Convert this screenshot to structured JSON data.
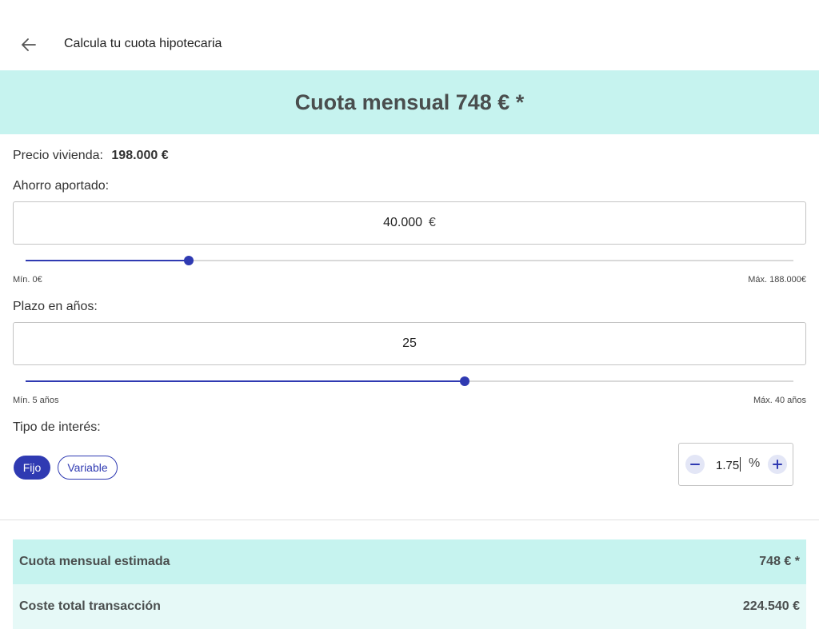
{
  "header": {
    "title": "Calcula tu cuota hipotecaria"
  },
  "banner": {
    "text": "Cuota mensual 748 € *"
  },
  "price": {
    "label": "Precio vivienda:",
    "value": "198.000 €"
  },
  "savings": {
    "label": "Ahorro aportado:",
    "value": "40.000",
    "unit": "€",
    "slider_value": 40000,
    "slider_min": 0,
    "slider_max": 188000,
    "min_label": "Mín. 0€",
    "max_label": "Máx. 188.000€"
  },
  "term": {
    "label": "Plazo en años:",
    "value": "25",
    "slider_value": 25,
    "slider_min": 5,
    "slider_max": 40,
    "min_label": "Mín. 5 años",
    "max_label": "Máx. 40 años"
  },
  "interest": {
    "label": "Tipo de interés:",
    "options": [
      "Fijo",
      "Variable"
    ],
    "selected": "Fijo",
    "value": "1.75",
    "unit": "%"
  },
  "summary": [
    {
      "label": "Cuota mensual estimada",
      "value": "748 € *"
    },
    {
      "label": "Coste total transacción",
      "value": "224.540 €"
    }
  ],
  "colors": {
    "accent": "#2f3ab2",
    "banner_bg": "#c6f3ef",
    "row_alt_bg": "#e6f9f7"
  },
  "icons": {
    "back": "arrow-left-icon",
    "decrement": "minus-icon",
    "increment": "plus-icon"
  }
}
